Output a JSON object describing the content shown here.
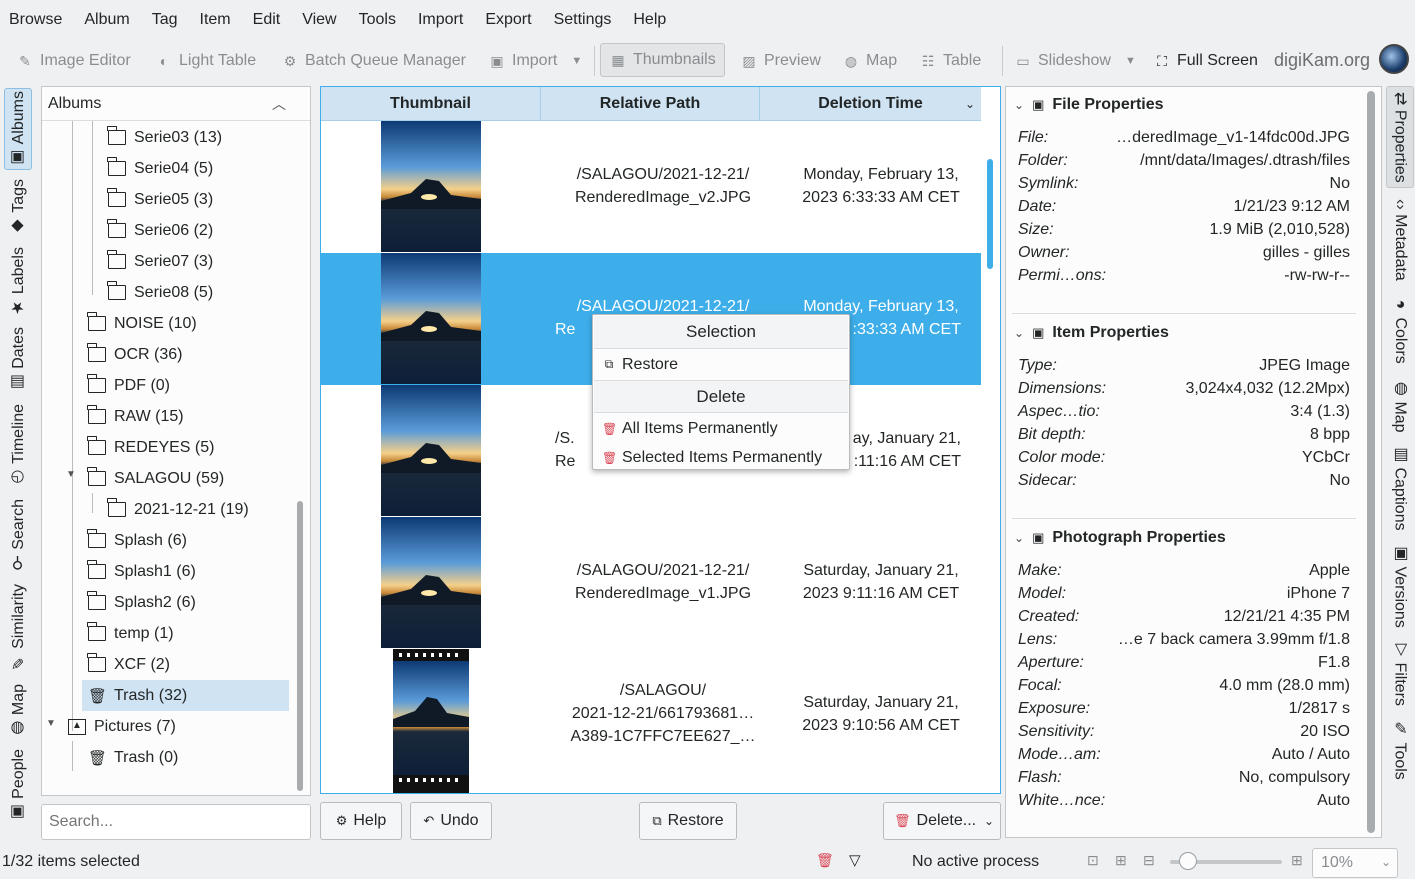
{
  "menu": [
    "Browse",
    "Album",
    "Tag",
    "Item",
    "Edit",
    "View",
    "Tools",
    "Import",
    "Export",
    "Settings",
    "Help"
  ],
  "toolbar": {
    "image_editor": "Image Editor",
    "light_table": "Light Table",
    "batch_queue": "Batch Queue Manager",
    "import": "Import",
    "thumbnails": "Thumbnails",
    "preview": "Preview",
    "map": "Map",
    "table": "Table",
    "slideshow": "Slideshow",
    "full_screen": "Full Screen",
    "brand": "digiKam.org"
  },
  "left_tabs": [
    "Albums",
    "Tags",
    "Labels",
    "Dates",
    "Timeline",
    "Search",
    "Similarity",
    "Map",
    "People"
  ],
  "right_tabs": [
    "Properties",
    "Metadata",
    "Colors",
    "Map",
    "Captions",
    "Versions",
    "Filters",
    "Tools"
  ],
  "albums": {
    "header": "Albums",
    "items": [
      "Serie03 (13)",
      "Serie04 (5)",
      "Serie05 (3)",
      "Serie06 (2)",
      "Serie07 (3)",
      "Serie08 (5)",
      "NOISE (10)",
      "OCR (36)",
      "PDF (0)",
      "RAW (15)",
      "REDEYES (5)",
      "SALAGOU (59)",
      "2021-12-21 (19)",
      "Splash (6)",
      "Splash1 (6)",
      "Splash2 (6)",
      "temp (1)",
      "XCF (2)",
      "Trash (32)",
      "Pictures (7)",
      "Trash (0)"
    ],
    "search_placeholder": "Search..."
  },
  "table": {
    "headers": [
      "Thumbnail",
      "Relative Path",
      "Deletion Time"
    ],
    "rows": [
      {
        "path1": "/SALAGOU/2021-12-21/",
        "path2": "RenderedImage_v2.JPG",
        "path3": "",
        "time1": "Monday, February 13,",
        "time2": "2023 6:33:33 AM CET"
      },
      {
        "path1": "/SALAGOU/2021-12-21/",
        "path2": "Re",
        "path3": "",
        "time1": "Monday, February 13,",
        "time2": ":33:33 AM CET"
      },
      {
        "path1": "/S.",
        "path2": "Re",
        "path3": "",
        "time1": "ay, January 21,",
        "time2": ":11:16 AM CET"
      },
      {
        "path1": "/SALAGOU/2021-12-21/",
        "path2": "RenderedImage_v1.JPG",
        "path3": "",
        "time1": "Saturday, January 21,",
        "time2": "2023 9:11:16 AM CET"
      },
      {
        "path1": "/SALAGOU/",
        "path2": "2021-12-21/661793681…",
        "path3": "A389-1C7FFC7EE627_…",
        "time1": "Saturday, January 21,",
        "time2": "2023 9:10:56 AM CET"
      }
    ]
  },
  "context_menu": {
    "selection_title": "Selection",
    "restore": "Restore",
    "delete_title": "Delete",
    "all_permanently": "All Items Permanently",
    "selected_permanently": "Selected Items Permanently"
  },
  "buttons": {
    "help": "Help",
    "undo": "Undo",
    "restore": "Restore",
    "delete": "Delete..."
  },
  "file_properties": {
    "title": "File Properties",
    "rows": [
      {
        "k": "File:",
        "v": "…deredImage_v1-14fdc00d.JPG"
      },
      {
        "k": "Folder:",
        "v": "/mnt/data/Images/.dtrash/files"
      },
      {
        "k": "Symlink:",
        "v": "No"
      },
      {
        "k": "Date:",
        "v": "1/21/23 9:12 AM"
      },
      {
        "k": "Size:",
        "v": "1.9 MiB (2,010,528)"
      },
      {
        "k": "Owner:",
        "v": "gilles - gilles"
      },
      {
        "k": "Permi…ons:",
        "v": "-rw-rw-r--"
      }
    ]
  },
  "item_properties": {
    "title": "Item Properties",
    "rows": [
      {
        "k": "Type:",
        "v": "JPEG Image"
      },
      {
        "k": "Dimensions:",
        "v": "3,024x4,032 (12.2Mpx)"
      },
      {
        "k": "Aspec…tio:",
        "v": "3:4 (1.3)"
      },
      {
        "k": "Bit depth:",
        "v": "8 bpp"
      },
      {
        "k": "Color mode:",
        "v": "YCbCr"
      },
      {
        "k": "Sidecar:",
        "v": "No"
      }
    ]
  },
  "photo_properties": {
    "title": "Photograph Properties",
    "rows": [
      {
        "k": "Make:",
        "v": "Apple"
      },
      {
        "k": "Model:",
        "v": "iPhone 7"
      },
      {
        "k": "Created:",
        "v": "12/21/21 4:35 PM"
      },
      {
        "k": "Lens:",
        "v": "…e 7 back camera 3.99mm f/1.8"
      },
      {
        "k": "Aperture:",
        "v": "F1.8"
      },
      {
        "k": "Focal:",
        "v": "4.0 mm (28.0 mm)"
      },
      {
        "k": "Exposure:",
        "v": "1/2817 s"
      },
      {
        "k": "Sensitivity:",
        "v": "20 ISO"
      },
      {
        "k": "Mode…am:",
        "v": "Auto / Auto"
      },
      {
        "k": "Flash:",
        "v": "No, compulsory"
      },
      {
        "k": "White…nce:",
        "v": "Auto"
      }
    ]
  },
  "status": {
    "selected": "1/32 items selected",
    "process": "No active process",
    "zoom": "10%",
    "zoom_level": 0.1
  },
  "colors": {
    "accent": "#3daee9",
    "selection_light": "#cfe3f2",
    "delete_red": "#da4453"
  }
}
